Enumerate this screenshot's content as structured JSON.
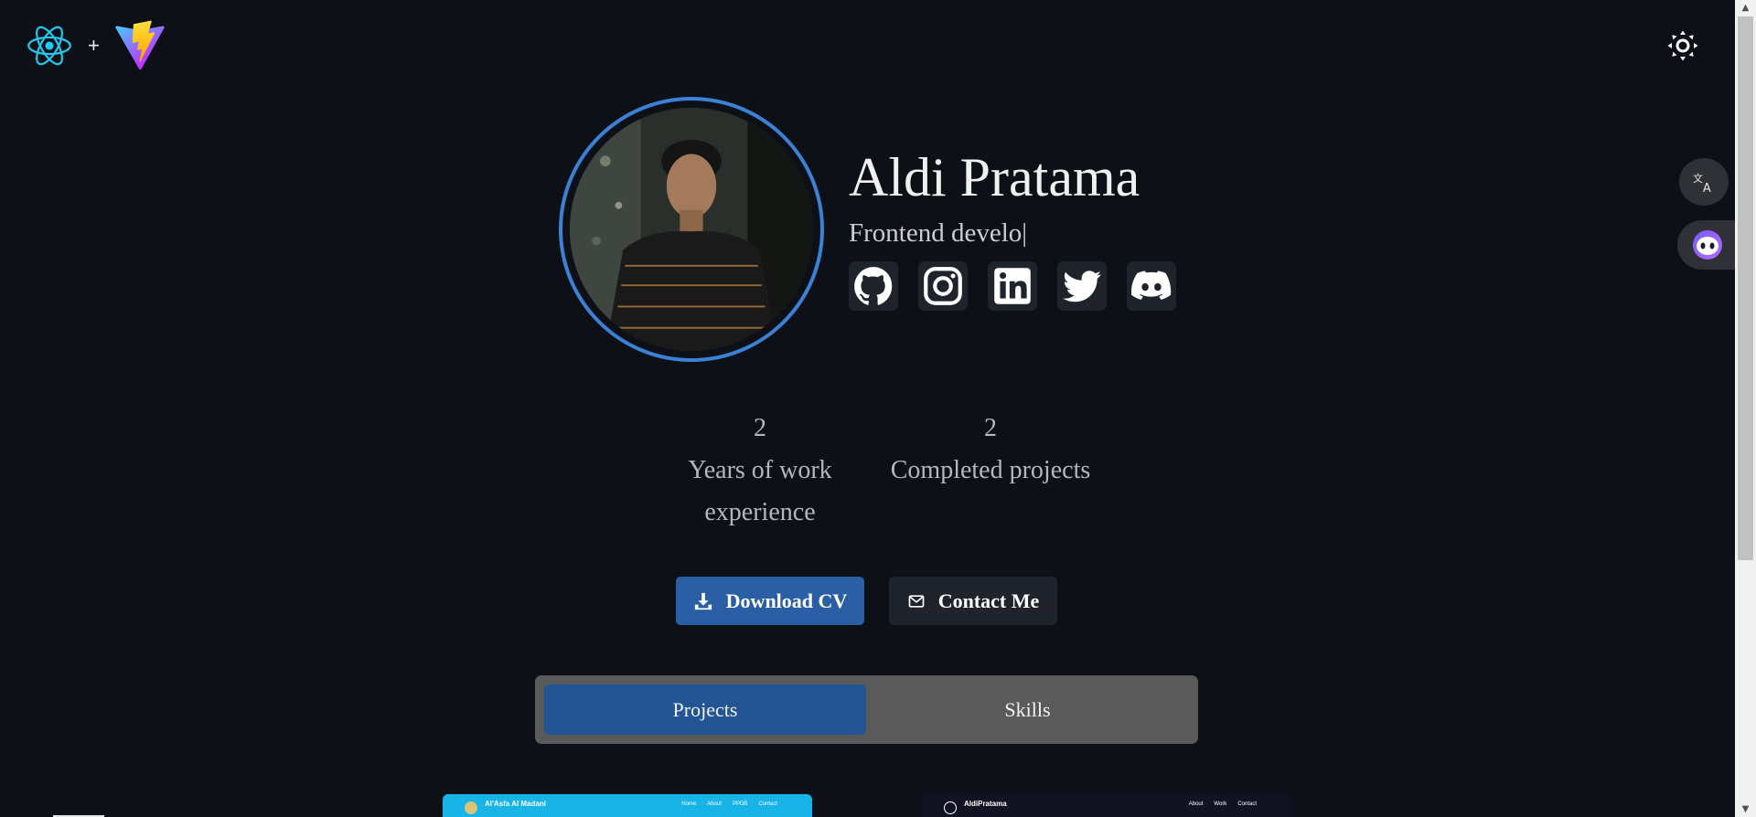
{
  "header": {
    "logo_plus": "+",
    "icons": [
      "react-logo",
      "vite-logo",
      "sun-icon"
    ]
  },
  "hero": {
    "name": "Aldi Pratama",
    "role_typed": "Frontend develo|",
    "avatar_alt": "profile photo",
    "socials": [
      {
        "name": "github",
        "icon": "github-icon"
      },
      {
        "name": "instagram",
        "icon": "instagram-icon"
      },
      {
        "name": "linkedin",
        "icon": "linkedin-icon"
      },
      {
        "name": "twitter",
        "icon": "twitter-icon"
      },
      {
        "name": "discord",
        "icon": "discord-icon"
      }
    ]
  },
  "stats": [
    {
      "value": "2",
      "label_line1": "Years of work",
      "label_line2": "experience"
    },
    {
      "value": "2",
      "label_line1": "Completed projects",
      "label_line2": ""
    }
  ],
  "actions": {
    "download_cv": "Download CV",
    "contact_me": "Contact Me"
  },
  "tabs": {
    "projects": "Projects",
    "skills": "Skills",
    "active": "Projects"
  },
  "projects_preview": [
    {
      "brand": "Al'Asfa Al Madani",
      "nav": [
        "Home",
        "About",
        "PPDB",
        "Contact"
      ]
    },
    {
      "brand": "AldiPratama",
      "nav": [
        "About",
        "Work",
        "Contact"
      ]
    }
  ],
  "colors": {
    "background": "#0d1117",
    "accent": "#2a5ea5",
    "avatar_ring": "#3b82d6",
    "tab_bar": "#5a5a5a"
  }
}
